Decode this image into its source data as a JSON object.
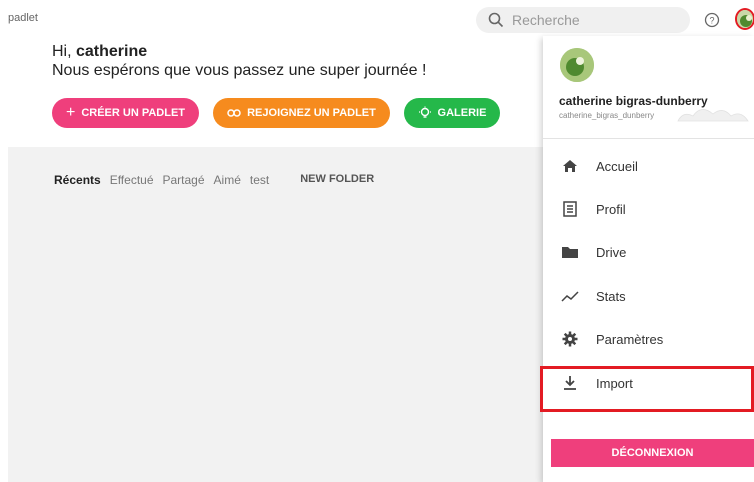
{
  "app": {
    "logo": "padlet"
  },
  "search": {
    "placeholder": "Recherche"
  },
  "greeting": {
    "hi": "Hi, ",
    "name": "catherine",
    "message": "Nous espérons que vous passez une super journée !"
  },
  "actions": {
    "create": "CRÉER UN PADLET",
    "join": "REJOIGNEZ UN PADLET",
    "gallery": "GALERIE"
  },
  "tabs": [
    {
      "label": "Récents"
    },
    {
      "label": "Effectué"
    },
    {
      "label": "Partagé"
    },
    {
      "label": "Aimé"
    },
    {
      "label": "test"
    }
  ],
  "new_folder": "NEW FOLDER",
  "menu": {
    "name": "catherine bigras-dunberry",
    "username": "catherine_bigras_dunberry",
    "items": [
      {
        "label": "Accueil",
        "icon": "home-icon"
      },
      {
        "label": "Profil",
        "icon": "profile-card-icon"
      },
      {
        "label": "Drive",
        "icon": "folder-icon"
      },
      {
        "label": "Stats",
        "icon": "stats-line-icon"
      },
      {
        "label": "Paramètres",
        "icon": "gear-icon"
      },
      {
        "label": "Import",
        "icon": "download-icon"
      }
    ],
    "logout": "DÉCONNEXION"
  },
  "colors": {
    "pink": "#ef3f7c",
    "orange": "#f68b1e",
    "green": "#25b84a",
    "highlight": "#e31b23"
  }
}
